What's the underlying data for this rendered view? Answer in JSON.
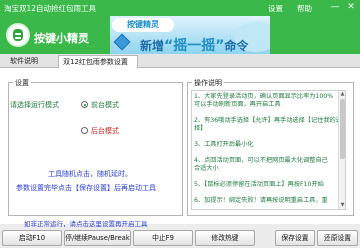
{
  "window": {
    "title": "淘宝双12自动抢红包雨工具",
    "menu": [
      "设置",
      "帮助"
    ],
    "min_label": "—",
    "close_label": "✕"
  },
  "brand": {
    "name": "按键小精灵"
  },
  "banner": {
    "tag": "按键精灵",
    "slogan_prefix": "新增",
    "slogan_highlight": "“摇一摇”",
    "slogan_suffix": "命令"
  },
  "tabs": [
    {
      "label": "软件说明",
      "active": false
    },
    {
      "label": "双12红包雨参数设置",
      "active": true
    }
  ],
  "settings": {
    "legend": "设置",
    "mode_label": "请选择运行模式",
    "options": [
      {
        "label": "前台模式",
        "checked": true
      },
      {
        "label": "后台模式",
        "checked": false
      }
    ],
    "note": "工具随机点击，随机延时。",
    "hint": "参数设置完毕点击【保存设置】后再启动工具"
  },
  "help": {
    "legend": "操作说明",
    "lines": [
      "1、大家先登录活动页，确认页面显示比率为100%",
      "   可以手动刷新页面，再开启工具",
      "",
      "2、有36哦动手选择【允许】再手动选择【记住我的选",
      "   择】",
      "",
      "3、工具打开后最小化",
      "",
      "4、点回活动页面，可以不把网页最大化调整自己",
      "   合适大小",
      "",
      "5、【鼠标必须停留在活动页面上】再按F10开始",
      "",
      "6、加提示！绑定失败！请再按说明重启工具，重"
    ]
  },
  "status": {
    "text": "如非正常运行，请点击这里设置再开启工具"
  },
  "buttons": [
    {
      "label": "启动F10"
    },
    {
      "label": "停/继续Pause/Break"
    },
    {
      "label": "中止F9"
    },
    {
      "label": "修改热键"
    },
    {
      "label": "保存设置"
    },
    {
      "label": "还原设置"
    }
  ],
  "colors": {
    "brand_green": "#3ab84a",
    "option_green": "#1f7a3d",
    "option_red": "#d21f1f",
    "note_blue": "#2a3ed8"
  }
}
